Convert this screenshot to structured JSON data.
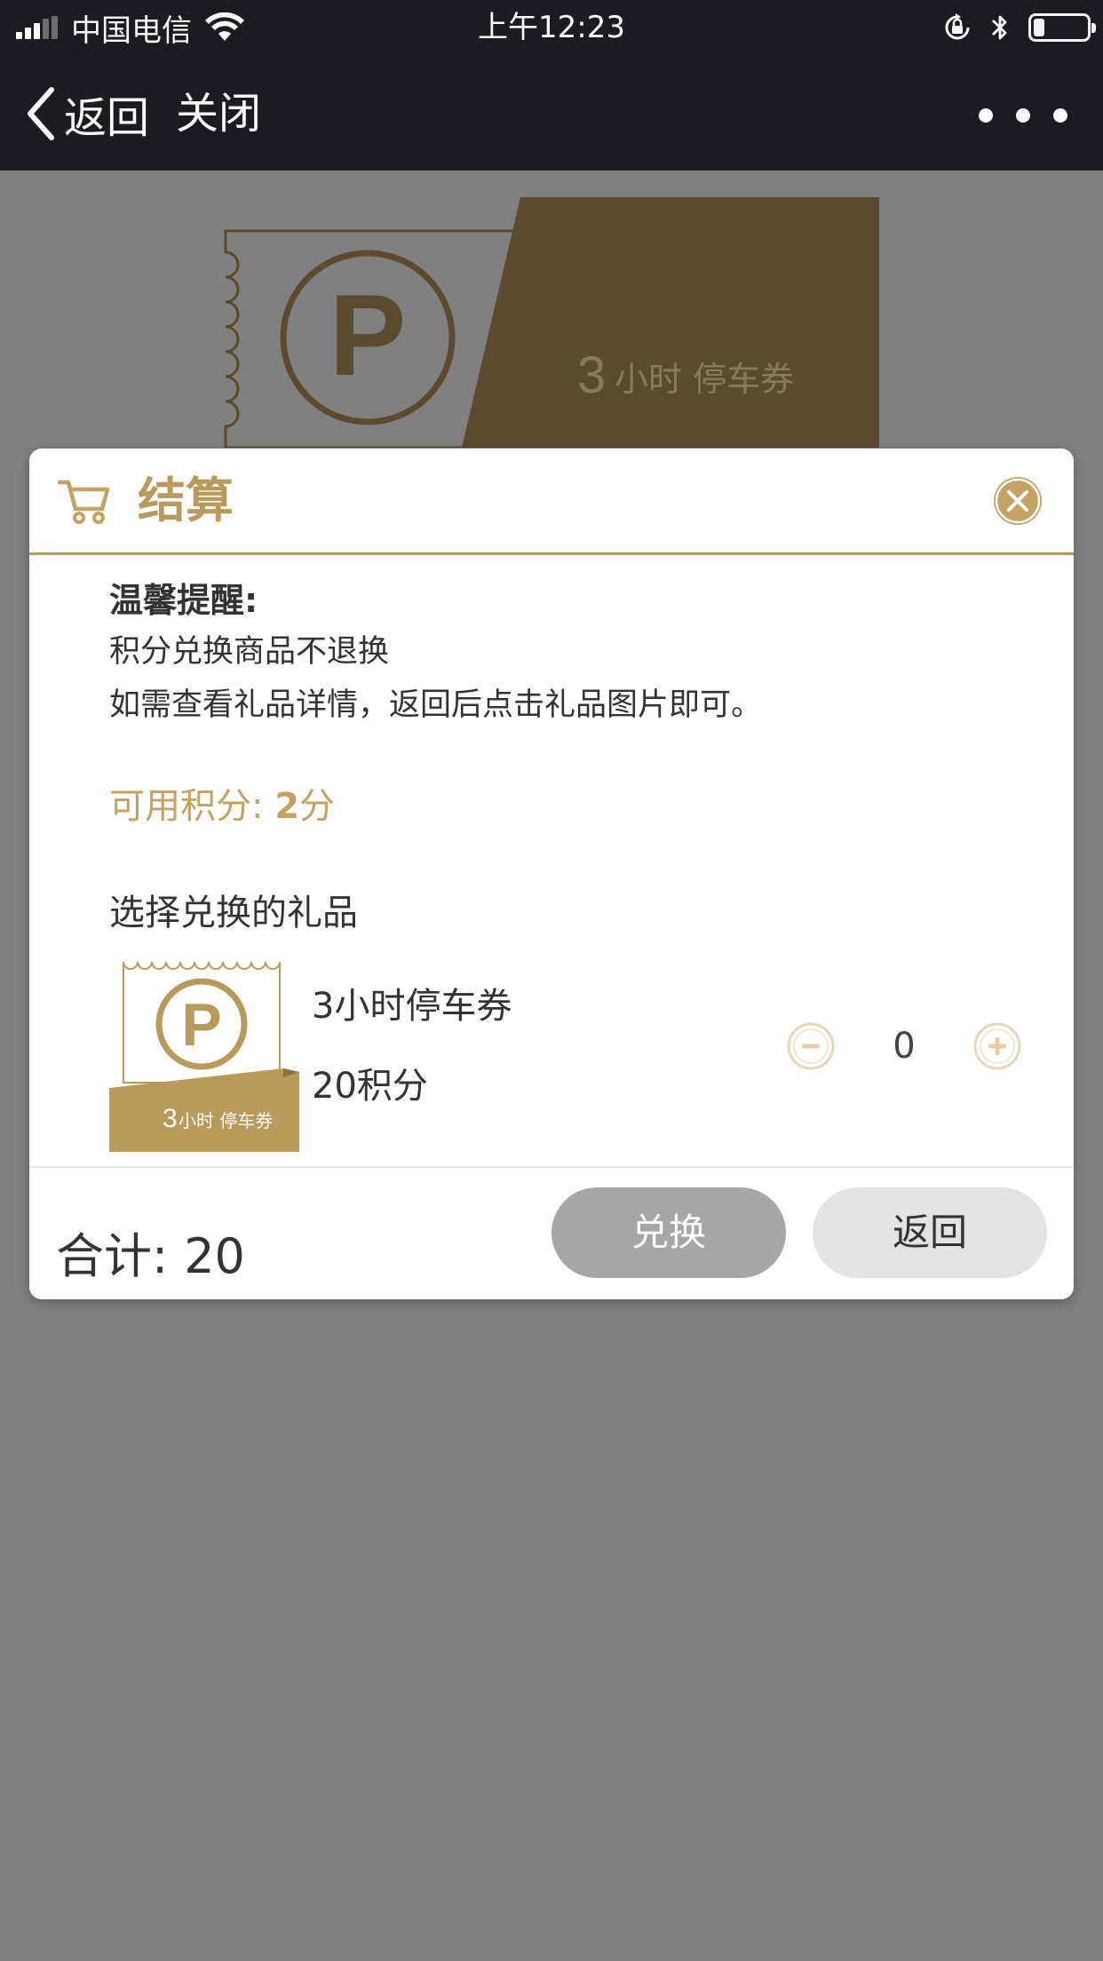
{
  "status_bar": {
    "carrier": "中国电信",
    "time": "上午12:23",
    "battery_level": 0.2
  },
  "nav": {
    "back_label": "返回",
    "close_label": "关闭"
  },
  "banner": {
    "ticket_text_number": "3",
    "ticket_text_rest": "小时 停车券"
  },
  "modal": {
    "title": "结算",
    "tip_title": "温馨提醒:",
    "tip_lines": [
      "积分兑换商品不退换",
      "如需查看礼品详情，返回后点击礼品图片即可。"
    ],
    "points_label": "可用积分: ",
    "points_value": "2",
    "points_unit": "分",
    "select_label": "选择兑换的礼品",
    "gift": {
      "name": "3小时停车券",
      "cost": "20积分",
      "thumb_text_number": "3",
      "thumb_text_rest": "小时 停车券",
      "quantity": "0"
    },
    "total_label": "合计:",
    "total_value": "20",
    "exchange_button": "兑换",
    "back_button": "返回"
  },
  "colors": {
    "accent": "#b89a5a",
    "accent_dark": "#5b4a2d",
    "overlay": "#808080",
    "header_bg": "#1b1b21"
  }
}
